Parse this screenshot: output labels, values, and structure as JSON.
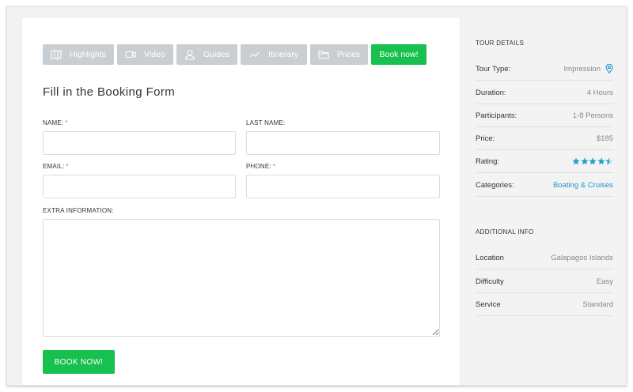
{
  "tabs": [
    {
      "label": "Highlights",
      "icon": "map-icon"
    },
    {
      "label": "Video",
      "icon": "video-icon"
    },
    {
      "label": "Guides",
      "icon": "user-icon"
    },
    {
      "label": "Itinerary",
      "icon": "trend-icon"
    },
    {
      "label": "Prices",
      "icon": "folder-icon"
    },
    {
      "label": "Book now!",
      "icon": null
    }
  ],
  "form": {
    "title": "Fill in the Booking Form",
    "name_label": "NAME:",
    "last_name_label": "LAST NAME:",
    "email_label": "EMAIL:",
    "phone_label": "PHONE:",
    "extra_label": "EXTRA INFORMATION:",
    "required_mark": "*",
    "name_value": "",
    "last_name_value": "",
    "email_value": "",
    "phone_value": "",
    "extra_value": "",
    "submit_label": "BOOK NOW!"
  },
  "tour_details": {
    "heading": "TOUR DETAILS",
    "tour_type": {
      "label": "Tour Type:",
      "value": "Impression",
      "icon": "location-pin-icon"
    },
    "duration": {
      "label": "Duration:",
      "value": "4 Hours"
    },
    "participants": {
      "label": "Participants:",
      "value": "1-8 Persons"
    },
    "price": {
      "label": "Price:",
      "value": "$185"
    },
    "rating": {
      "label": "Rating:",
      "stars": 4.5,
      "max": 5
    },
    "categories": {
      "label": "Categories:",
      "value": "Boating & Cruises"
    }
  },
  "additional_info": {
    "heading": "ADDITIONAL INFO",
    "location": {
      "label": "Location",
      "value": "Galapagos Islands"
    },
    "difficulty": {
      "label": "Difficulty",
      "value": "Easy"
    },
    "service": {
      "label": "Service",
      "value": "Standard"
    }
  },
  "colors": {
    "accent_green": "#18c04f",
    "tab_grey": "#c9ced3",
    "link_blue": "#1d96c9",
    "star_blue": "#1aa4c9"
  }
}
